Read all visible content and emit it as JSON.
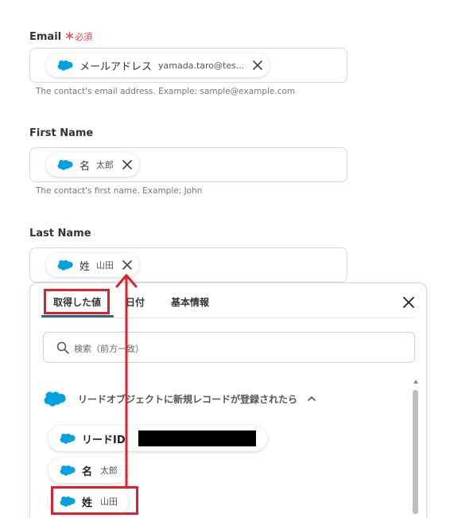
{
  "fields": [
    {
      "label": "Email",
      "required_mark": "＊",
      "required_text": "必須",
      "chip_label": "メールアドレス",
      "chip_value": "yamada.taro@tes...",
      "help": "The contact's email address. Example: sample@example.com"
    },
    {
      "label": "First Name",
      "chip_label": "名",
      "chip_value": "太郎",
      "help": "The contact's first name. Example: John"
    },
    {
      "label": "Last Name",
      "chip_label": "姓",
      "chip_value": "山田"
    }
  ],
  "picker": {
    "tabs": [
      {
        "label": "取得した値",
        "active": true
      },
      {
        "label": "日付",
        "active": false
      },
      {
        "label": "基本情報",
        "active": false
      }
    ],
    "search_placeholder": "検索（前方一致）",
    "section_title": "リードオブジェクトに新規レコードが登録されたら",
    "results": [
      {
        "label": "リードID",
        "value": "",
        "redacted": true
      },
      {
        "label": "名",
        "value": "太郎"
      },
      {
        "label": "姓",
        "value": "山田",
        "highlighted": true
      }
    ]
  },
  "colors": {
    "salesforce_blue": "#00a1e0",
    "required_red": "#e5484d",
    "highlight_red": "#e0202f",
    "tab_underline": "#2c6b7a"
  },
  "icons": [
    "salesforce-cloud-icon",
    "close-icon",
    "search-icon",
    "chevron-up-icon",
    "arrow-icon"
  ]
}
